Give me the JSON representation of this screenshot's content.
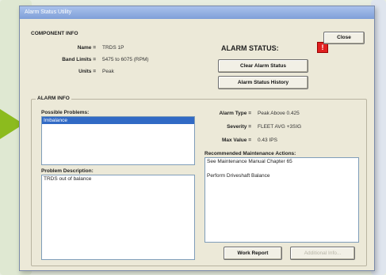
{
  "window": {
    "title": "Alarm Status Utility"
  },
  "component_info": {
    "heading": "COMPONENT INFO",
    "name_label": "Name =",
    "name_value": "TRDS 1P",
    "band_limits_label": "Band Limits =",
    "band_limits_value": "5475 to 6075 (RPM)",
    "units_label": "Units =",
    "units_value": "Peak"
  },
  "alarm_status": {
    "label": "ALARM STATUS:",
    "indicator": "!",
    "indicator_color": "#e02020"
  },
  "buttons": {
    "close": "Close",
    "clear_alarm_status": "Clear Alarm Status",
    "alarm_status_history": "Alarm Status History",
    "work_report": "Work Report",
    "additional_info": "Additional Info..."
  },
  "alarm_info": {
    "heading": "ALARM INFO",
    "possible_problems_label": "Possible Problems:",
    "possible_problems": [
      "Imbalance"
    ],
    "alarm_type_label": "Alarm Type =",
    "alarm_type_value": "Peak Above 0.425",
    "severity_label": "Severity =",
    "severity_value": "FLEET AVG +3SIG",
    "max_value_label": "Max Value =",
    "max_value_value": "0.43 IPS",
    "problem_description_label": "Problem Description:",
    "problem_description_lines": [
      "TRDS out of balance"
    ],
    "recommended_label": "Recommended Maintenance Actions:",
    "recommended_lines": [
      "See Maintenance Manual Chapter 65",
      "",
      "Perform Driveshaft Balance"
    ]
  },
  "colors": {
    "accent_arrow": "#8cbb1e",
    "selection": "#316ac5"
  }
}
